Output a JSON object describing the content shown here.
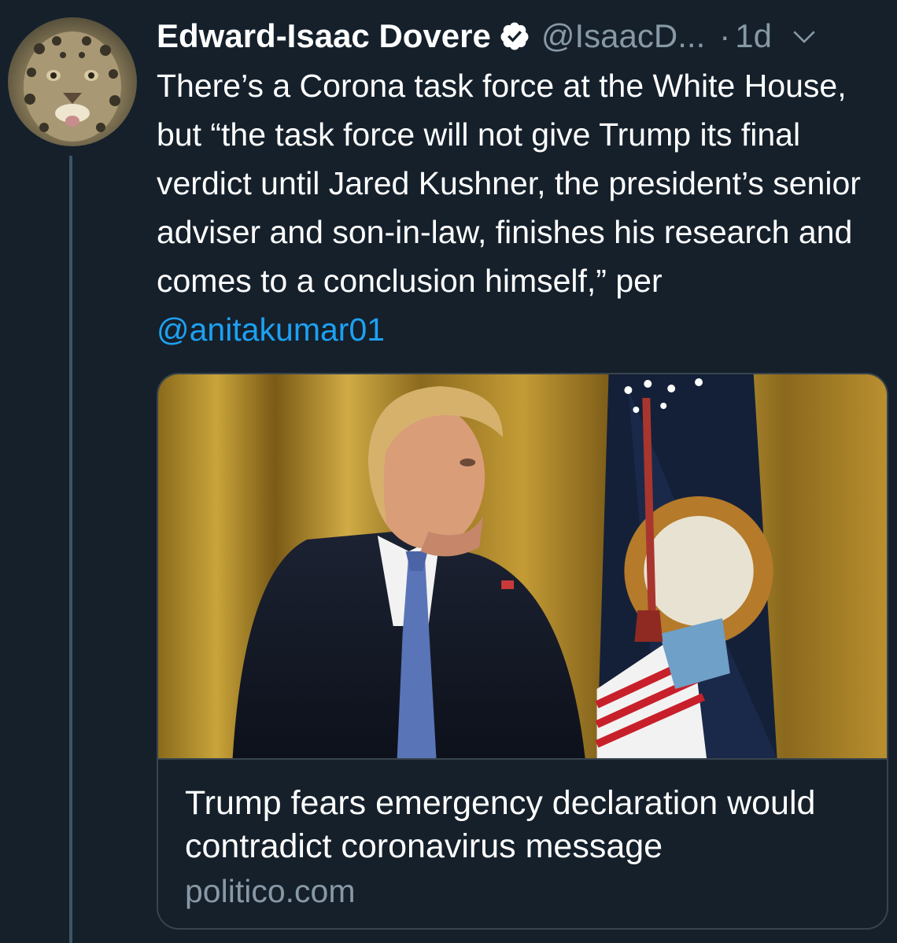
{
  "tweet": {
    "author": {
      "name": "Edward-Isaac Dovere",
      "handle": "@IsaacD...",
      "verified": true,
      "avatar_icon": "jaguar-avatar"
    },
    "separator": "·",
    "timestamp": "1d",
    "menu_icon": "chevron-down-icon",
    "text_main": "There’s a Corona task force at the White House, but “the task force will not give Trump its final verdict until Jared Kushner, the president’s senior adviser and son-in-law, finishes his research and comes to a conclusion himself,” per ",
    "mention": "@anitakumar01"
  },
  "link_card": {
    "image_icon": "article-photo",
    "title": "Trump fears emergency declaration would contradict coronavirus message",
    "domain": "politico.com"
  },
  "colors": {
    "background": "#15202b",
    "text": "#ffffff",
    "secondary_text": "#8899a6",
    "link": "#1da1f2",
    "border": "#38444d",
    "thread_line": "#3d5466"
  }
}
